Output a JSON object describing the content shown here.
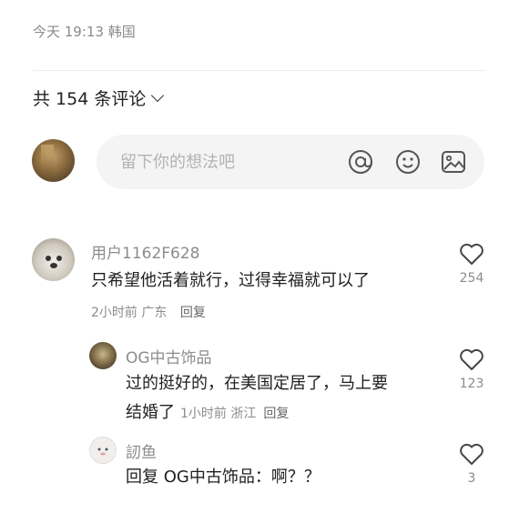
{
  "header": {
    "meta": "今天 19:13 韩国",
    "comment_count_label": "共 154 条评论"
  },
  "composer": {
    "placeholder": "留下你的想法吧",
    "icons": [
      "at-icon",
      "emoji-icon",
      "image-icon"
    ]
  },
  "comments": [
    {
      "user": "用户1162F628",
      "text": "只希望他活着就行，过得幸福就可以了",
      "time": "2小时前",
      "location": "广东",
      "reply_label": "回复",
      "likes": "254"
    }
  ],
  "replies": [
    {
      "user": "OG中古饰品",
      "text_line1": "过的挺好的，在美国定居了，马上要",
      "text_line2": "结婚了",
      "time": "1小时前",
      "location": "浙江",
      "reply_label": "回复",
      "likes": "123"
    },
    {
      "user": "訒鱼",
      "text": "回复 OG中古饰品：啊？？",
      "likes": "3"
    }
  ]
}
